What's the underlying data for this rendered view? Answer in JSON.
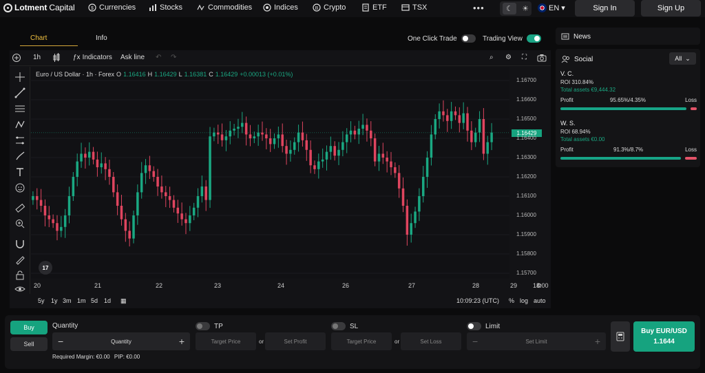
{
  "brand": {
    "name_bold": "Lotment",
    "name_light": "Capital"
  },
  "nav": [
    {
      "label": "Currencies",
      "icon": "currency-icon"
    },
    {
      "label": "Stocks",
      "icon": "stocks-icon"
    },
    {
      "label": "Commodities",
      "icon": "commodities-icon"
    },
    {
      "label": "Indices",
      "icon": "indices-icon"
    },
    {
      "label": "Crypto",
      "icon": "bitcoin-icon"
    },
    {
      "label": "ETF",
      "icon": "etf-icon"
    },
    {
      "label": "TSX",
      "icon": "tsx-icon"
    }
  ],
  "more": "•••",
  "language": "EN",
  "auth": {
    "sign_in": "Sign In",
    "sign_up": "Sign Up"
  },
  "tabs": {
    "chart": "Chart",
    "info": "Info"
  },
  "toggles": {
    "one_click": "One Click Trade",
    "trading_view": "Trading View"
  },
  "chart_toolbar": {
    "interval": "1h",
    "indicators": "Indicators",
    "ask_line": "Ask line"
  },
  "legend": {
    "symbol": "Euro / US Dollar · 1h · Forex",
    "o_label": "O",
    "o": "1.16416",
    "h_label": "H",
    "h": "1.16429",
    "l_label": "L",
    "l": "1.16381",
    "c_label": "C",
    "c": "1.16429",
    "change": "+0.00013 (+0.01%)"
  },
  "price_ticks": [
    "1.16700",
    "1.16600",
    "1.16500",
    "1.16400",
    "1.16300",
    "1.16200",
    "1.16100",
    "1.16000",
    "1.15900",
    "1.15800",
    "1.15700"
  ],
  "current_price": "1.16429",
  "time_ticks": [
    "20",
    "21",
    "22",
    "23",
    "24",
    "26",
    "27",
    "28",
    "29",
    "18:00"
  ],
  "ranges": [
    "5y",
    "1y",
    "3m",
    "1m",
    "5d",
    "1d"
  ],
  "clock": "10:09:23 (UTC)",
  "scale_opts": {
    "pct": "%",
    "log": "log",
    "auto": "auto"
  },
  "tv_badge": "17",
  "news": {
    "title": "News"
  },
  "social": {
    "title": "Social",
    "filter": "All",
    "traders": [
      {
        "name": "V. C.",
        "roi": "ROI 310.84%",
        "assets": "Total assets €9,444.32",
        "profit_label": "Profit",
        "ratio": "95.65%/4.35%",
        "loss_label": "Loss",
        "profit_pct": 95.65
      },
      {
        "name": "W. S.",
        "roi": "ROI 68.94%",
        "assets": "Total assets €0.00",
        "profit_label": "Profit",
        "ratio": "91.3%/8.7%",
        "loss_label": "Loss",
        "profit_pct": 91.3
      }
    ]
  },
  "trade": {
    "buy_tab": "Buy",
    "sell_tab": "Sell",
    "quantity_label": "Quantity",
    "quantity_placeholder": "Quantity",
    "tp_label": "TP",
    "sl_label": "SL",
    "limit_label": "Limit",
    "target_price": "Target Price",
    "set_profit": "Set Profit",
    "set_loss": "Set Loss",
    "set_limit": "Set Limit",
    "or": "or",
    "required_margin_label": "Required Margin:",
    "required_margin": "€0.00",
    "pip_label": "PIP:",
    "pip": "€0.00",
    "buy_button": "Buy EUR/USD",
    "buy_price": "1.1644"
  },
  "colors": {
    "up": "#1aa882",
    "down": "#e0455f",
    "accent": "#16a37f"
  },
  "chart_data": {
    "type": "candlestick",
    "y_range": [
      1.157,
      1.1675
    ],
    "x_ticks": [
      "20",
      "21",
      "22",
      "23",
      "24",
      "26",
      "27",
      "28",
      "29",
      "18:00"
    ],
    "closes": [
      1.161,
      1.1608,
      1.1605,
      1.16,
      1.1598,
      1.1596,
      1.1592,
      1.1594,
      1.16,
      1.161,
      1.162,
      1.1628,
      1.1632,
      1.163,
      1.1633,
      1.1629,
      1.1625,
      1.1627,
      1.1624,
      1.162,
      1.1612,
      1.1605,
      1.1598,
      1.1592,
      1.1588,
      1.16,
      1.1612,
      1.1622,
      1.1626,
      1.1623,
      1.162,
      1.1615,
      1.1612,
      1.161,
      1.1608,
      1.1604,
      1.1601,
      1.1598,
      1.1596,
      1.16,
      1.1604,
      1.161,
      1.1615,
      1.1608,
      1.1641,
      1.1643,
      1.1642,
      1.1639,
      1.1641,
      1.1644,
      1.1645,
      1.1646,
      1.1648,
      1.1642,
      1.164,
      1.1641,
      1.1643,
      1.1642,
      1.164,
      1.1637,
      1.164,
      1.1642,
      1.1636,
      1.1632,
      1.1634,
      1.1638,
      1.1643,
      1.1639,
      1.1634,
      1.1626,
      1.1624,
      1.1628,
      1.1629,
      1.1633,
      1.1636,
      1.1631,
      1.1634,
      1.1638,
      1.1642,
      1.1644,
      1.1642,
      1.1645,
      1.1647,
      1.1644,
      1.164,
      1.1628,
      1.1632,
      1.163,
      1.1628,
      1.1625,
      1.1622,
      1.1614,
      1.1605,
      1.159,
      1.1596,
      1.1602,
      1.161,
      1.162,
      1.163,
      1.1642,
      1.165,
      1.1654,
      1.1652,
      1.1649,
      1.1654,
      1.1652,
      1.1648,
      1.1653,
      1.1644,
      1.1638,
      1.1643,
      1.165,
      1.1632,
      1.1638,
      1.1643
    ]
  }
}
